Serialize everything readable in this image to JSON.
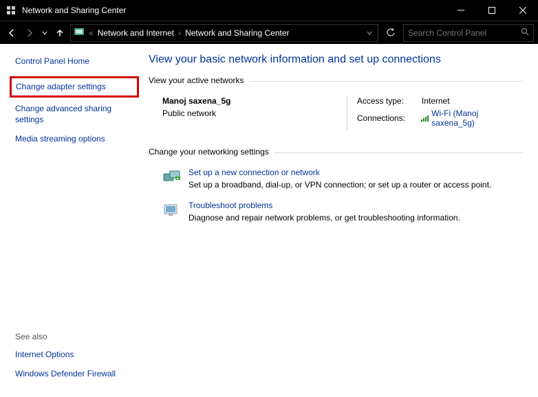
{
  "window": {
    "title": "Network and Sharing Center"
  },
  "address": {
    "prefix": "«",
    "crumb1": "Network and Internet",
    "crumb2": "Network and Sharing Center"
  },
  "search": {
    "placeholder": "Search Control Panel"
  },
  "sidebar": {
    "cp_home": "Control Panel Home",
    "change_adapter": "Change adapter settings",
    "change_advanced": "Change advanced sharing settings",
    "media_streaming": "Media streaming options",
    "see_also": "See also",
    "internet_options": "Internet Options",
    "defender": "Windows Defender Firewall"
  },
  "main": {
    "heading": "View your basic network information and set up connections",
    "active_h": "View your active networks",
    "net_name": "Manoj saxena_5g",
    "net_type": "Public network",
    "access_label": "Access type:",
    "access_value": "Internet",
    "conn_label": "Connections:",
    "conn_value": "Wi-Fi (Manoj saxena_5g)",
    "change_h": "Change your networking settings",
    "setup_title": "Set up a new connection or network",
    "setup_desc": "Set up a broadband, dial-up, or VPN connection; or set up a router or access point.",
    "trouble_title": "Troubleshoot problems",
    "trouble_desc": "Diagnose and repair network problems, or get troubleshooting information."
  }
}
